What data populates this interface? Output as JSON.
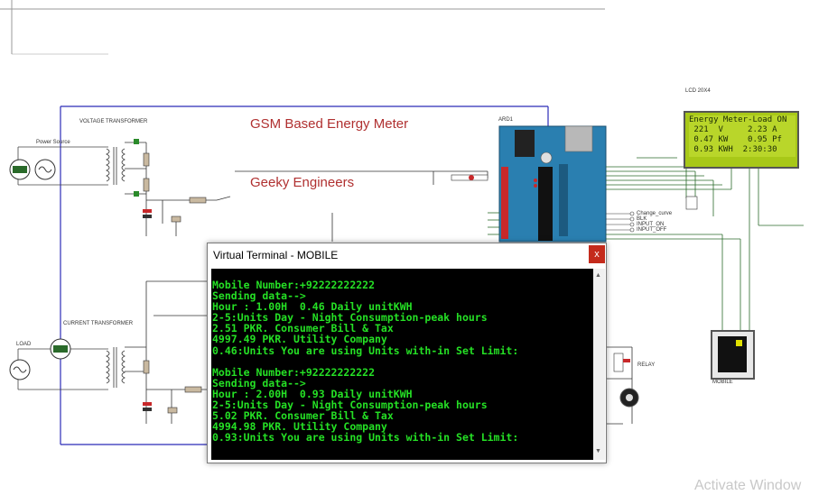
{
  "schematic": {
    "title": "GSM  Based Energy Meter",
    "subtitle": "Geeky Engineers",
    "voltage_transformer_label": "VOLTAGE TRANSFORMER",
    "current_transformer_label": "CURRENT TRANSFORMER",
    "arduino_label": "ARD1",
    "lcd_label": "LCD 20X4",
    "mobile_label": "MOBILE",
    "relay_label": "RELAY",
    "power_source_label": "Power Source",
    "load_label": "LOAD",
    "pin_labels": [
      "Change_curve",
      "BLK",
      "INPUT_ON",
      "INPUT_OFF"
    ]
  },
  "lcd": {
    "lines": [
      "Energy Meter-Load ON",
      " 221  V     2.23 A",
      " 0.47 KW    0.95 Pf",
      " 0.93 KWH  2:30:30"
    ]
  },
  "terminal": {
    "title": "Virtual Terminal - MOBILE",
    "close_label": "x",
    "blocks": [
      [
        "Mobile Number:+92222222222",
        "Sending data-->",
        "Hour : 1.00H  0.46 Daily unitKWH",
        "2-5:Units Day - Night Consumption-peak hours",
        "2.51 PKR. Consumer Bill & Tax",
        "4997.49 PKR. Utility Company",
        "0.46:Units You are using Units with-in Set Limit:"
      ],
      [
        "Mobile Number:+92222222222",
        "Sending data-->",
        "Hour : 2.00H  0.93 Daily unitKWH",
        "2-5:Units Day - Night Consumption-peak hours",
        "5.02 PKR. Consumer Bill & Tax",
        "4994.98 PKR. Utility Company",
        "0.93:Units You are using Units with-in Set Limit:"
      ]
    ]
  },
  "watermark": "Activate Window"
}
